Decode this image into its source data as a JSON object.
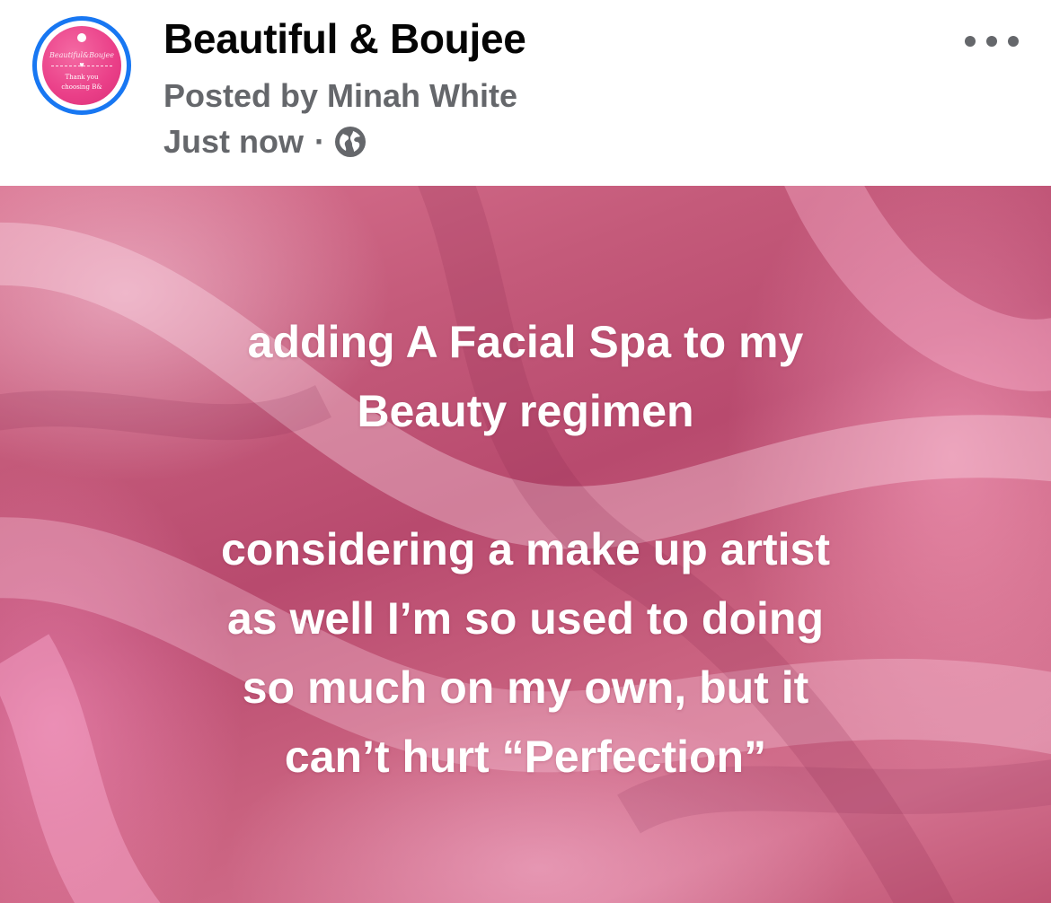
{
  "post": {
    "page_name": "Beautiful & Boujee",
    "posted_by": "Posted by Minah White",
    "timestamp": "Just now",
    "separator": "·",
    "audience_icon": "globe-icon",
    "menu_icon": "more-options-icon",
    "avatar": {
      "script_text": "Beautiful&Boujee",
      "line1": "Thank you",
      "line2": "choosing B&",
      "bg_color": "#ea3f88",
      "ring_color": "#1877f2"
    }
  },
  "background_text": {
    "lines": [
      "adding A Facial Spa to my",
      "Beauty regimen",
      "",
      "considering a make up artist",
      "as well I’m so used to doing",
      "so much on my own, but it",
      "can’t hurt “Perfection”"
    ]
  },
  "colors": {
    "name_text": "#050505",
    "meta_text": "#65676b",
    "background_base": "#c45a7a"
  }
}
